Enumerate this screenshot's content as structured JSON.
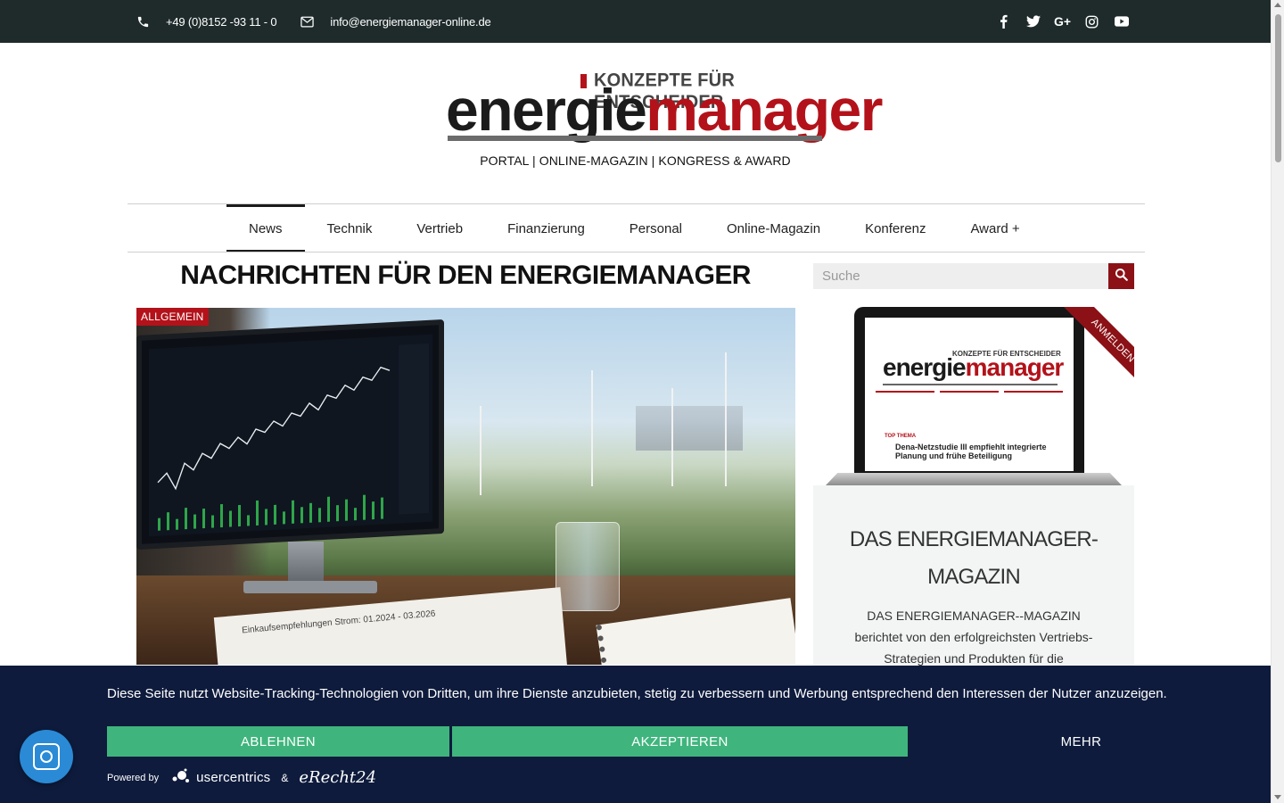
{
  "topbar": {
    "phone": "+49 (0)8152 -93 11 - 0",
    "email": "info@energiemanager-online.de",
    "social": [
      "facebook-icon",
      "twitter-icon",
      "google-plus-icon",
      "instagram-icon",
      "youtube-icon"
    ]
  },
  "logo": {
    "kicker": "KONZEPTE FÜR ENTSCHEIDER",
    "word_a": "energie",
    "word_b": "manager"
  },
  "tagline": "PORTAL | ONLINE-MAGAZIN | KONGRESS & AWARD",
  "nav": {
    "items": [
      {
        "label": "News",
        "active": true
      },
      {
        "label": "Technik"
      },
      {
        "label": "Vertrieb"
      },
      {
        "label": "Finanzierung"
      },
      {
        "label": "Personal"
      },
      {
        "label": "Online-Magazin"
      },
      {
        "label": "Konferenz"
      },
      {
        "label": "Award +"
      }
    ]
  },
  "main": {
    "headline": "NACHRICHTEN FÜR DEN ENERGIEMANAGER",
    "badge": "ALLGEMEIN",
    "hero_paper": "Einkaufsempfehlungen Strom: 01.2024 - 03.2026"
  },
  "sidebar": {
    "search_placeholder": "Suche",
    "ribbon": "ANMELDEN",
    "mag_title": "DAS ENERGIEMANAGER-MAGAZIN",
    "mag_text": "DAS ENERGIEMANAGER--MAGAZIN berichtet von den erfolgreichsten Vertriebs-Strategien und Produkten für die Energiewende.",
    "laptop_top": "TOP THEMA",
    "laptop_head": "Dena-Netzstudie III empfiehlt integrierte Planung und frühe Beteiligung"
  },
  "cookie": {
    "message": "Diese Seite nutzt Website-Tracking-Technologien von Dritten, um ihre Dienste anzubieten, stetig zu verbessern und Werbung entsprechend den Interessen der Nutzer anzuzeigen.",
    "decline": "ABLEHNEN",
    "accept": "AKZEPTIEREN",
    "more": "MEHR",
    "powered_by": "Powered by",
    "usercentrics": "usercentrics",
    "amp": "&",
    "erecht": "eRecht24"
  },
  "colors": {
    "topbar": "#1f2b2b",
    "brand_red": "#b3121a",
    "cookie_bg": "#0e1b3c",
    "cookie_btn": "#3fb57d"
  }
}
